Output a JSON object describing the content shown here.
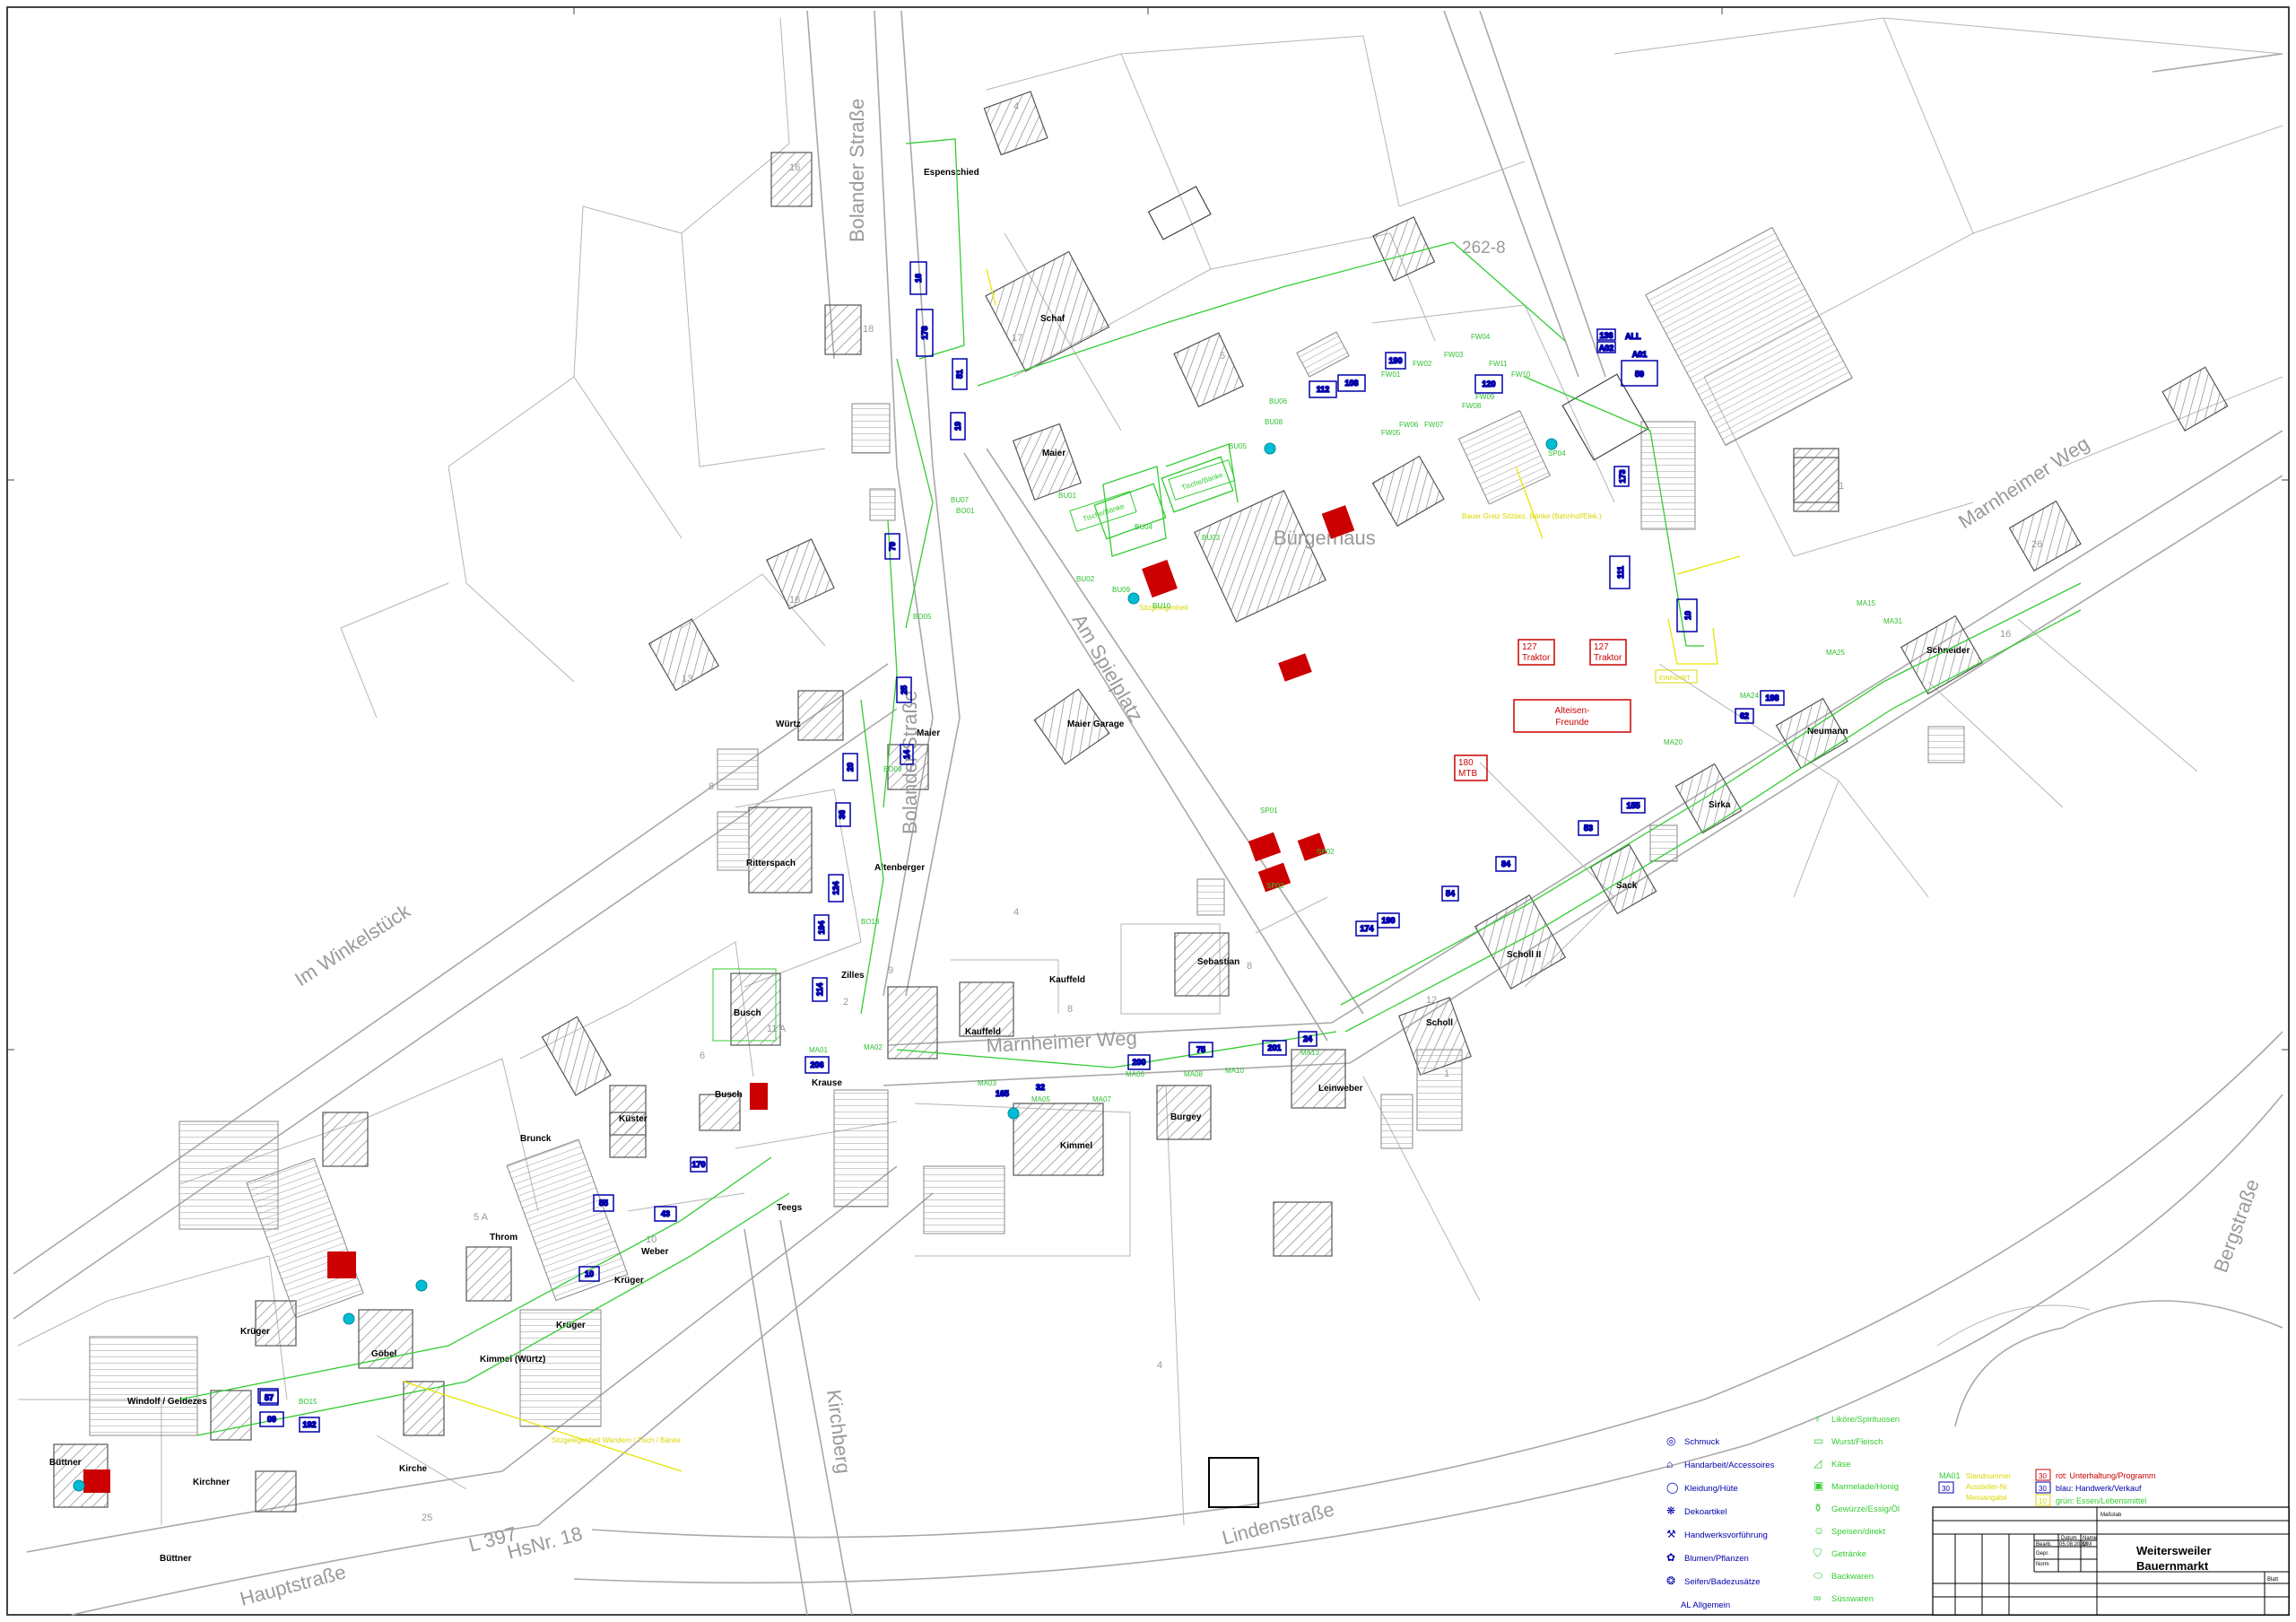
{
  "title": {
    "line1": "Weitersweiler",
    "line2": "Bauernmarkt"
  },
  "streets": {
    "im_winkelstueck": "Im Winkelstück",
    "bolander_strasse_north": "Bolander Straße",
    "bolander_strasse_south": "Bolander Straße",
    "am_spielplatz": "Am Spielplatz",
    "marnheimer_weg_east": "Marnheimer Weg",
    "marnheimer_weg_center": "Marnheimer Weg",
    "bergstrasse": "Bergstraße",
    "lindenstrasse": "Lindenstraße",
    "kirchberg": "Kirchberg",
    "hauptstrasse": "Hauptstraße",
    "l397": "L 397",
    "hsnr": "HsNr. 18"
  },
  "parcel_labels": {
    "p262_8": "262-8",
    "buergerhaus": "Bürgerhaus"
  },
  "owners": [
    "Espenschied",
    "Schaf",
    "Maier",
    "Würtz",
    "Maier",
    "Maier Garage",
    "Ritterspach",
    "Altenberger",
    "Zilles",
    "Busch",
    "Busch",
    "Kauffeld",
    "Kauffeld",
    "Krause",
    "Küster",
    "Brunck",
    "Throm",
    "Weber",
    "Krüger",
    "Krüger",
    "Kimmel (Würtz)",
    "Göbel",
    "Krüger",
    "Windolf / Geldezes",
    "Kirchner",
    "Büttner",
    "Büttner",
    "Kirche",
    "Sebastian",
    "Burgey",
    "Kimmel",
    "Leinweber",
    "Scholl",
    "Scholl II",
    "Sack",
    "Sirka",
    "Neumann",
    "Schneider",
    "Teegs"
  ],
  "house_numbers": [
    "4",
    "16",
    "18",
    "16",
    "13",
    "8",
    "17",
    "5",
    "1",
    "6",
    "9",
    "26",
    "25",
    "16",
    "4",
    "8",
    "5 A",
    "11 A",
    "10",
    "4",
    "2",
    "8",
    "1",
    "12"
  ],
  "program_boxes": [
    {
      "line1": "127",
      "line2": "Traktor"
    },
    {
      "line1": "127",
      "line2": "Traktor"
    },
    {
      "line1": "Alteisen-",
      "line2": "Freunde"
    },
    {
      "line1": "180",
      "line2": "MTB"
    }
  ],
  "blue_stalls": [
    "16",
    "178",
    "19",
    "25",
    "20",
    "36",
    "124",
    "114",
    "14",
    "51",
    "79",
    "194",
    "112",
    "108",
    "190",
    "120",
    "59",
    "136",
    "ALL",
    "A02",
    "A01",
    "174",
    "190",
    "54",
    "84",
    "53",
    "155",
    "62",
    "198",
    "200",
    "75",
    "201",
    "24",
    "206",
    "165",
    "32",
    "57",
    "09",
    "192",
    "55",
    "43",
    "170",
    "10",
    "173",
    "10",
    "111"
  ],
  "green_codes": [
    "BU01",
    "BU02",
    "BU03",
    "BU04",
    "BU05",
    "BU06",
    "BU07",
    "BU08",
    "BU09",
    "BU10",
    "FW01",
    "FW02",
    "FW03",
    "FW04",
    "FW05",
    "FW06",
    "FW07",
    "FW08",
    "FW09",
    "FW10",
    "FW11",
    "MA01",
    "MA02",
    "MA03",
    "MA05",
    "MA06",
    "MA07",
    "MA08",
    "MA10",
    "MA13",
    "MA15",
    "MA20",
    "MA24",
    "MA25",
    "MA31",
    "SP01",
    "SP02",
    "SP03",
    "SP04",
    "BO01",
    "BO05",
    "BO09",
    "BO13",
    "BO15"
  ],
  "area_notes": [
    "Tische/Bänke",
    "Tische/Bänke",
    "Bauer Greiz  Sitzbez. Bänke (Bahnhof/Elek.)",
    "Sitzgelegenheit",
    "EINFAHRT",
    "Sitzgelegenheit Wandern / Tisch / Bänke"
  ],
  "legend": {
    "col1": [
      {
        "icon": "ring-icon",
        "label": "Schmuck"
      },
      {
        "icon": "hat-icon",
        "label": "Handarbeit/Accessoires"
      },
      {
        "icon": "clothes-icon",
        "label": "Kleidung/Hüte"
      },
      {
        "icon": "decor-icon",
        "label": "Dekoartikel"
      },
      {
        "icon": "hammer-icon",
        "label": "Handwerksvorführung"
      },
      {
        "icon": "flower-icon",
        "label": "Blumen/Pflanzen"
      },
      {
        "icon": "soap-icon",
        "label": "Seifen/Badezusätze"
      },
      {
        "icon": "general-icon",
        "label": "AL Allgemein"
      }
    ],
    "col2": [
      {
        "icon": "bottle-icon",
        "label": "Liköre/Spirituosen"
      },
      {
        "icon": "sausage-icon",
        "label": "Wurst/Fleisch"
      },
      {
        "icon": "cheese-icon",
        "label": "Käse"
      },
      {
        "icon": "jar-icon",
        "label": "Marmelade/Honig"
      },
      {
        "icon": "spice-icon",
        "label": "Gewürze/Essig/Öl"
      },
      {
        "icon": "food-icon",
        "label": "Speisen/direkt"
      },
      {
        "icon": "drink-icon",
        "label": "Getränke"
      },
      {
        "icon": "bread-icon",
        "label": "Backwaren"
      },
      {
        "icon": "candy-icon",
        "label": "Süsswaren"
      }
    ],
    "key": [
      {
        "code": "MA01",
        "swatch": "30",
        "text_a": "Standnummer",
        "text_b": "rot: Unterhaltung/Programm"
      },
      {
        "code": "",
        "swatch": "30",
        "text_a": "Aussteller-Nr.",
        "text_b": "blau: Handwerk/Verkauf"
      },
      {
        "code": "",
        "swatch": "10",
        "text_a": "Messangabe",
        "text_b": "grün: Essen/Lebensmittel"
      }
    ]
  },
  "titleblock": {
    "header": "Maßstab",
    "datum": "Datum",
    "name": "Name",
    "bearb": "Bearb.",
    "bearb_date": "05.08.2022",
    "bearb_name": "MM",
    "gepr": "Gepr.",
    "norm": "Norm",
    "blatt": "Blatt"
  },
  "colors": {
    "line": "#a8a8a8",
    "blue": "#0000aa",
    "green": "#33cc33",
    "yellow": "#e6e600",
    "red": "#cc0000",
    "cyan": "#00bcd4"
  }
}
